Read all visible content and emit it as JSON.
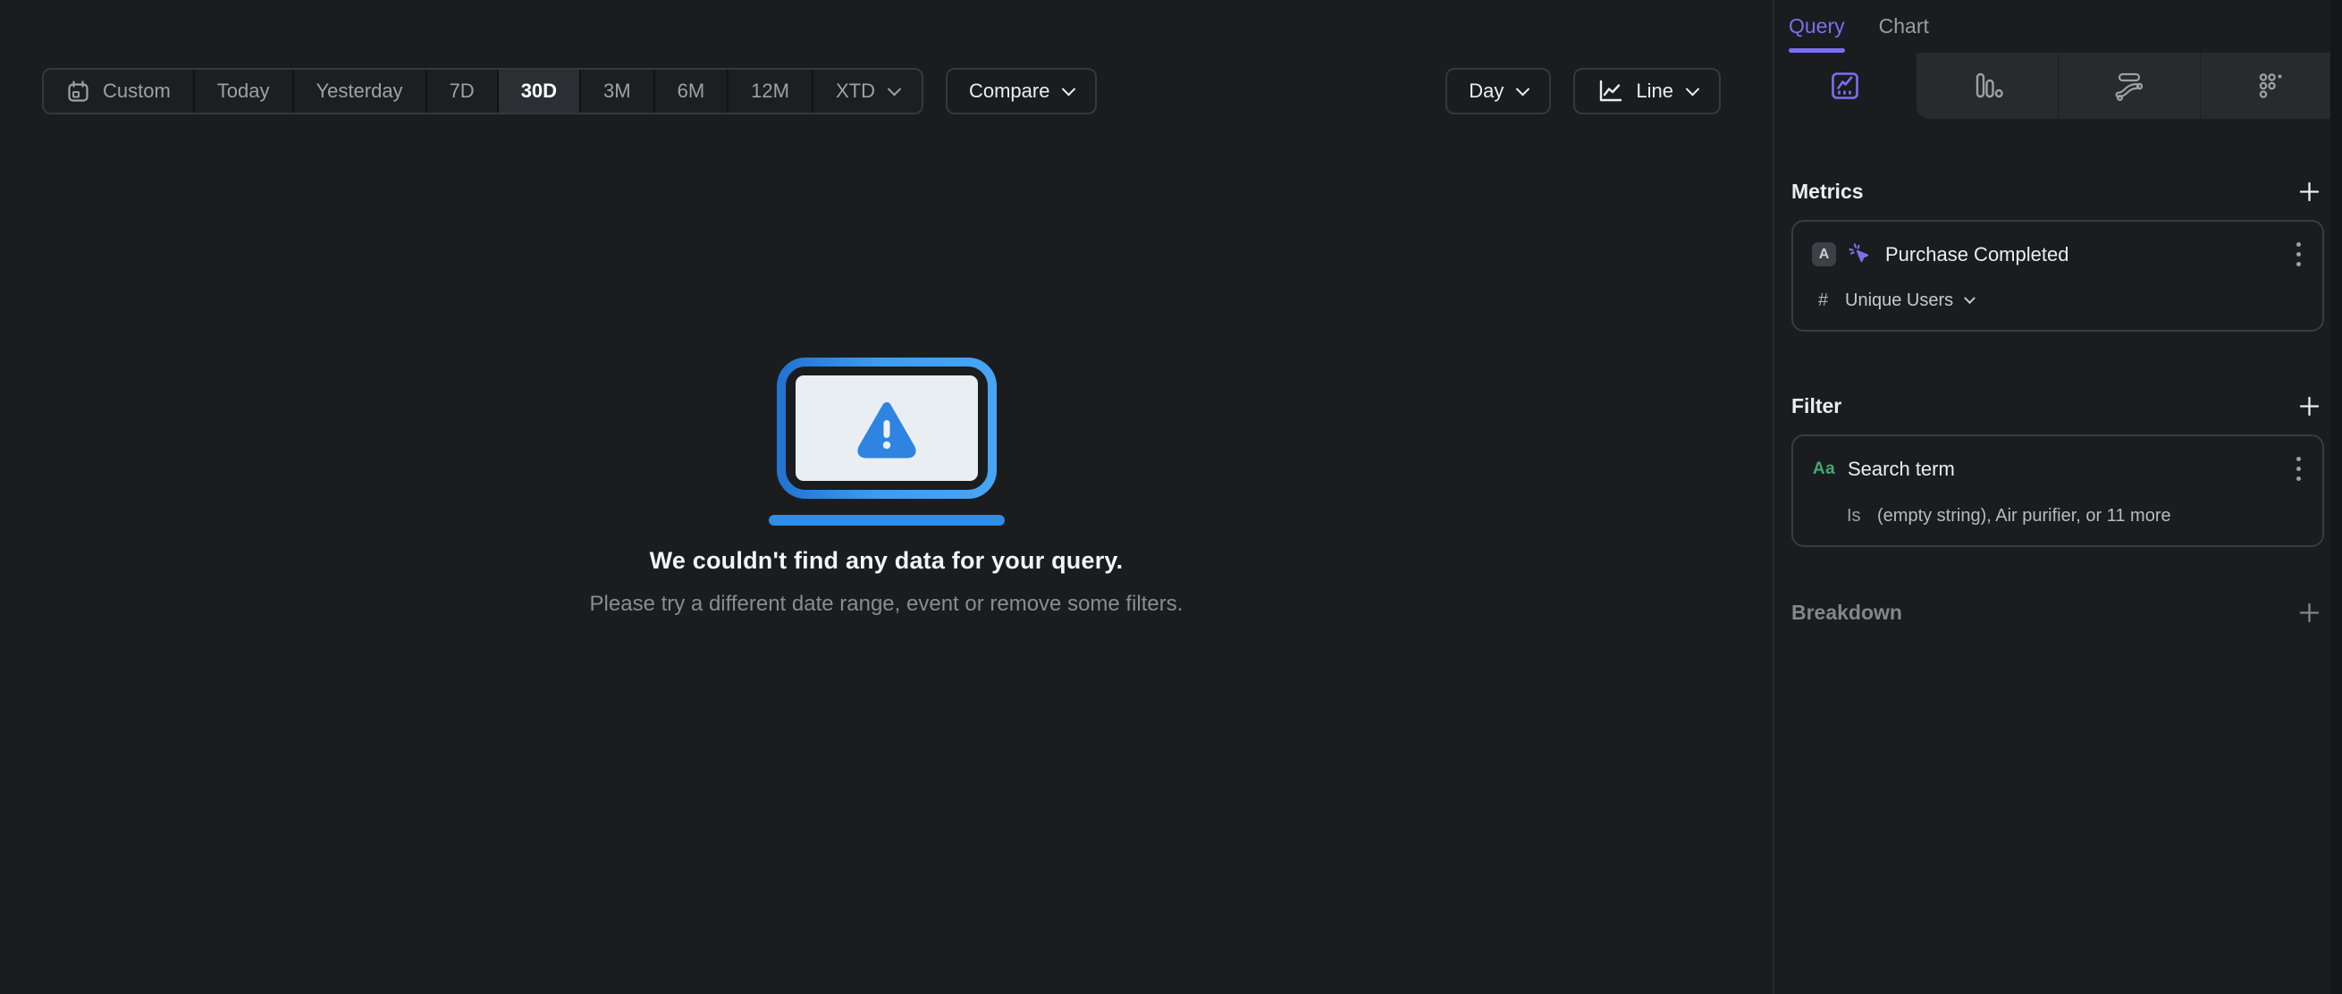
{
  "toolbar": {
    "ranges": [
      {
        "label": "Custom"
      },
      {
        "label": "Today"
      },
      {
        "label": "Yesterday"
      },
      {
        "label": "7D"
      },
      {
        "label": "30D"
      },
      {
        "label": "3M"
      },
      {
        "label": "6M"
      },
      {
        "label": "12M"
      },
      {
        "label": "XTD"
      }
    ],
    "selected_range": "30D",
    "compare_label": "Compare",
    "granularity_label": "Day",
    "chart_type_label": "Line"
  },
  "empty_state": {
    "title": "We couldn't find any data for your query.",
    "subtitle": "Please try a different date range, event or remove some filters."
  },
  "sidebar": {
    "tabs": [
      {
        "label": "Query",
        "active": true
      },
      {
        "label": "Chart",
        "active": false
      }
    ],
    "query_type_tabs": [
      {
        "icon": "insights-icon",
        "active": true
      },
      {
        "icon": "funnels-icon",
        "active": false
      },
      {
        "icon": "flows-icon",
        "active": false
      },
      {
        "icon": "retention-icon",
        "active": false
      }
    ],
    "metrics": {
      "heading": "Metrics",
      "card": {
        "series_letter": "A",
        "event_icon": "event-cursor-sparkle-icon",
        "event_name": "Purchase Completed",
        "aggregation_prefix": "#",
        "aggregation": "Unique Users"
      }
    },
    "filter": {
      "heading": "Filter",
      "card": {
        "type_badge": "Aa",
        "property": "Search term",
        "operator": "Is",
        "value": "(empty string), Air purifier, or 11 more"
      }
    },
    "breakdown": {
      "heading": "Breakdown"
    }
  },
  "colors": {
    "accent_purple": "#7b70f0",
    "string_green": "#43a878",
    "illustration_blue_light": "#3f9bef",
    "illustration_blue_dark": "#2273d2",
    "background": "#1b1c1f",
    "panel_strip": "#292a2e"
  }
}
